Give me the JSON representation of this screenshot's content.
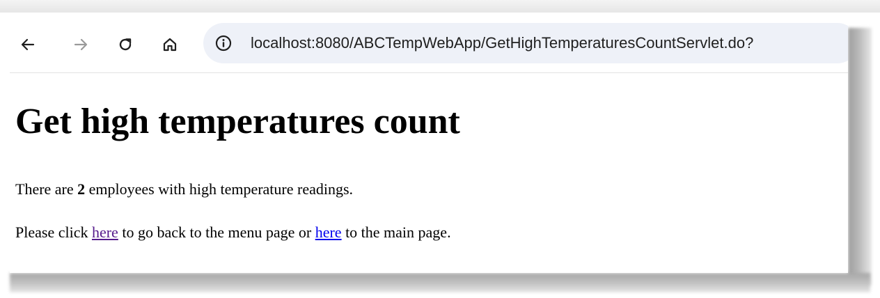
{
  "browser": {
    "url": "localhost:8080/ABCTempWebApp/GetHighTemperaturesCountServlet.do?",
    "icons": [
      "back-arrow-icon",
      "forward-arrow-icon",
      "reload-icon",
      "home-icon",
      "site-info-icon"
    ]
  },
  "page": {
    "heading": "Get high temperatures count",
    "count_sentence": {
      "prefix": "There are ",
      "count": "2",
      "suffix": " employees with high temperature readings."
    },
    "nav_sentence": {
      "prefix": "Please click ",
      "link1": "here",
      "middle": " to go back to the menu page or ",
      "link2": "here",
      "suffix": " to the main page."
    }
  },
  "colors": {
    "visited_link": "#551a8b",
    "link": "#0000ee",
    "omnibox_bg": "#eef1f8"
  }
}
